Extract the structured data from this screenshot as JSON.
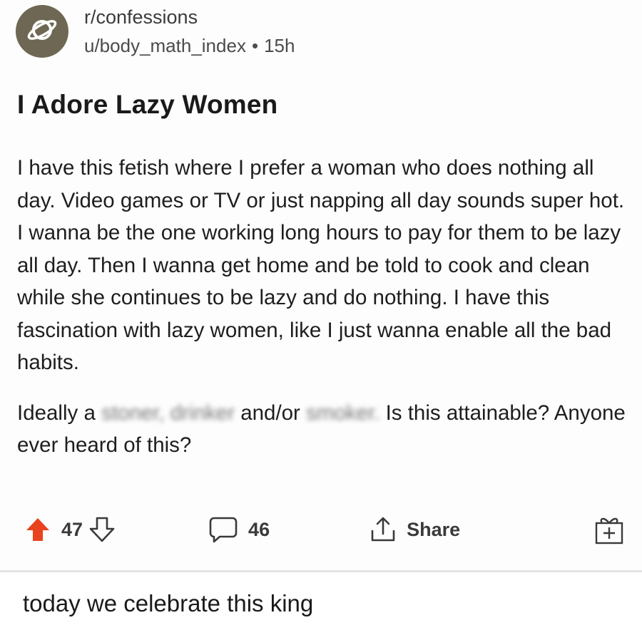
{
  "post": {
    "subreddit": "r/confessions",
    "username": "u/body_math_index",
    "separator": "•",
    "age": "15h",
    "title": "I Adore Lazy Women",
    "body_p1": "I have this fetish where I prefer a woman who does nothing all day. Video games or TV or just napping all day sounds super hot. I wanna be the one working long hours to pay for them to be lazy all day. Then I wanna get home and be told to cook and clean while she continues to be lazy and do nothing. I have this fascination with lazy women, like I just wanna enable all the bad habits.",
    "body_p2_start": "Ideally a",
    "body_p2_blurred_1": "stoner, drinker",
    "body_p2_middle": "and/or",
    "body_p2_blurred_2": "smoker.",
    "body_p2_end": "Is this attainable? Anyone ever heard of this?"
  },
  "actions": {
    "vote_count": "47",
    "comment_count": "46",
    "share_label": "Share"
  },
  "caption": "today we celebrate this king",
  "icons": {
    "avatar": "planet-icon",
    "upvote": "upvote-arrow-icon",
    "downvote": "downvote-arrow-icon",
    "comments": "speech-bubble-icon",
    "share": "share-arrow-icon",
    "award": "gift-award-icon"
  },
  "colors": {
    "upvote_active": "#e8431e",
    "avatar_bg": "#6e6753",
    "text": "#1c1c1c"
  }
}
